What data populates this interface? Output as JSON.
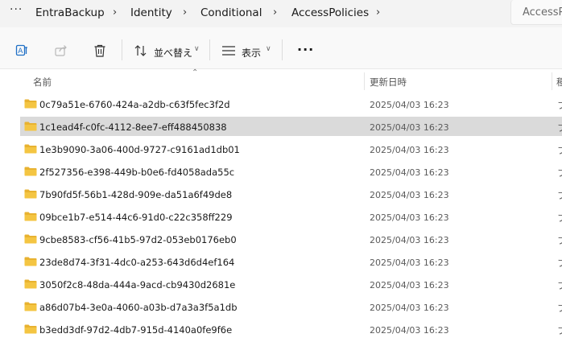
{
  "address_bar": {
    "more_label": "···",
    "crumbs": [
      "EntraBackup",
      "Identity",
      "Conditional",
      "AccessPolicies"
    ],
    "search_placeholder": "AccessP"
  },
  "toolbar": {
    "sort_label": "並べ替え",
    "view_label": "表示",
    "more_label": "···"
  },
  "columns": {
    "name": "名前",
    "modified": "更新日時",
    "type": "種"
  },
  "files": [
    {
      "name": "0c79a51e-6760-424a-a2db-c63f5fec3f2d",
      "modified": "2025/04/03 16:23",
      "type": "フ"
    },
    {
      "name": "1c1ead4f-c0fc-4112-8ee7-eff488450838",
      "modified": "2025/04/03 16:23",
      "type": "フ"
    },
    {
      "name": "1e3b9090-3a06-400d-9727-c9161ad1db01",
      "modified": "2025/04/03 16:23",
      "type": "フ"
    },
    {
      "name": "2f527356-e398-449b-b0e6-fd4058ada55c",
      "modified": "2025/04/03 16:23",
      "type": "フ"
    },
    {
      "name": "7b90fd5f-56b1-428d-909e-da51a6f49de8",
      "modified": "2025/04/03 16:23",
      "type": "フ"
    },
    {
      "name": "09bce1b7-e514-44c6-91d0-c22c358ff229",
      "modified": "2025/04/03 16:23",
      "type": "フ"
    },
    {
      "name": "9cbe8583-cf56-41b5-97d2-053eb0176eb0",
      "modified": "2025/04/03 16:23",
      "type": "フ"
    },
    {
      "name": "23de8d74-3f31-4dc0-a253-643d6d4ef164",
      "modified": "2025/04/03 16:23",
      "type": "フ"
    },
    {
      "name": "3050f2c8-48da-444a-9acd-cb9430d2681e",
      "modified": "2025/04/03 16:23",
      "type": "フ"
    },
    {
      "name": "a86d07b4-3e0a-4060-a03b-d7a3a3f5a1db",
      "modified": "2025/04/03 16:23",
      "type": "フ"
    },
    {
      "name": "b3edd3df-97d2-4db7-915d-4140a0fe9f6e",
      "modified": "2025/04/03 16:23",
      "type": "フ"
    }
  ],
  "selected_index": 1,
  "colors": {
    "folder": "#f4c542",
    "selected_row": "#dadada",
    "accent": "#0067c0"
  },
  "icons": [
    "more-icon",
    "chevron-right-icon",
    "translate-icon",
    "share-icon",
    "delete-icon",
    "sort-icon",
    "view-icon",
    "chevron-down-icon",
    "folder-icon"
  ]
}
